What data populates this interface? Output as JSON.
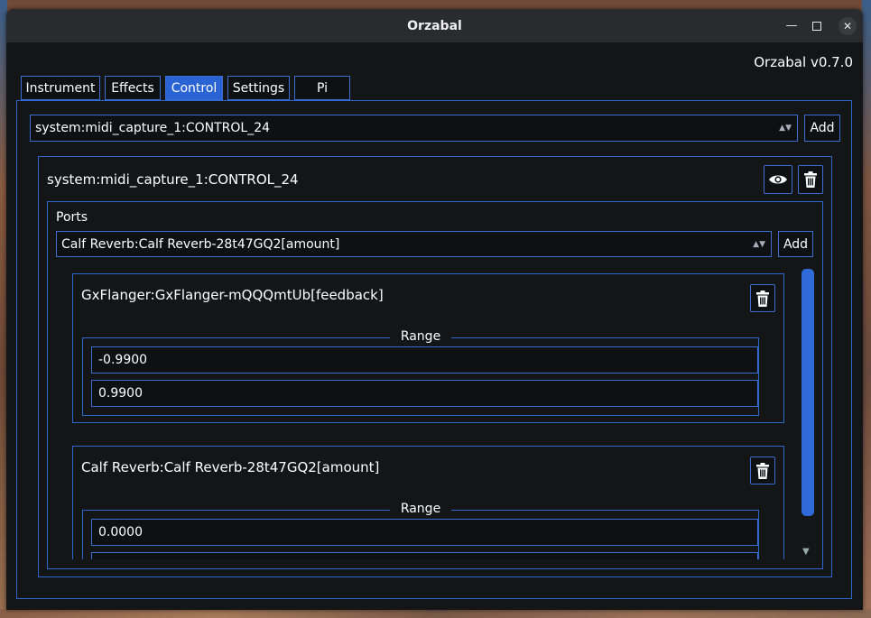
{
  "window": {
    "title": "Orzabal",
    "minimize": "—",
    "close": "✕"
  },
  "app": {
    "name": "Orzabal",
    "version": "v0.7.0"
  },
  "tabs": [
    {
      "label": "Instrument"
    },
    {
      "label": "Effects"
    },
    {
      "label": "Control",
      "active": true
    },
    {
      "label": "Settings"
    },
    {
      "label": "Pi"
    }
  ],
  "control": {
    "source_select_value": "system:midi_capture_1:CONTROL_24",
    "add_label": "Add",
    "card": {
      "title": "system:midi_capture_1:CONTROL_24",
      "ports_label": "Ports",
      "port_select_value": "Calf Reverb:Calf Reverb-28t47GQ2[amount]",
      "port_add_label": "Add",
      "ports": [
        {
          "name": "GxFlanger:GxFlanger-mQQQmtUb[feedback]",
          "range_label": "Range",
          "min": "-0.9900",
          "max": "0.9900"
        },
        {
          "name": "Calf Reverb:Calf Reverb-28t47GQ2[amount]",
          "range_label": "Range",
          "min": "0.0000",
          "max": ""
        }
      ]
    }
  },
  "icons": {
    "view": "eye-icon",
    "delete": "trash-icon",
    "dropdown": "chevron-down-icon"
  },
  "colors": {
    "accent": "#2f67d0",
    "active_tab": "#2a63d4",
    "background": "#141517"
  }
}
